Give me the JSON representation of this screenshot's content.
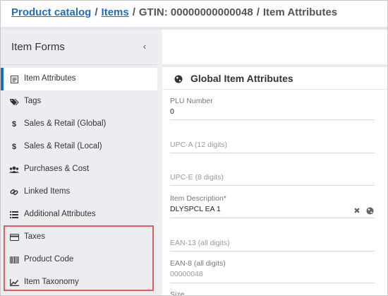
{
  "breadcrumb": {
    "product_catalog": "Product catalog",
    "sep1": "/",
    "items": "Items",
    "sep2": "/",
    "gtin": "GTIN: 00000000000048",
    "sep3": "/",
    "current": "Item Attributes"
  },
  "sidebar": {
    "title": "Item Forms",
    "collapse_glyph": "‹",
    "items": [
      {
        "label": "Item Attributes",
        "icon": "form-icon",
        "active": true
      },
      {
        "label": "Tags",
        "icon": "tags-icon"
      },
      {
        "label": "Sales & Retail (Global)",
        "icon": "dollar-icon"
      },
      {
        "label": "Sales & Retail (Local)",
        "icon": "dollar-icon"
      },
      {
        "label": "Purchases & Cost",
        "icon": "users-icon"
      },
      {
        "label": "Linked Items",
        "icon": "link-icon"
      },
      {
        "label": "Additional Attributes",
        "icon": "list-icon"
      },
      {
        "label": "Taxes",
        "icon": "credit-card-icon"
      },
      {
        "label": "Product Code",
        "icon": "barcode-icon"
      },
      {
        "label": "Item Taxonomy",
        "icon": "chart-line-icon"
      }
    ]
  },
  "panel": {
    "title": "Global Item Attributes",
    "fields": {
      "plu": {
        "label": "PLU Number",
        "value": "0"
      },
      "upca": {
        "placeholder": "UPC-A (12 digits)"
      },
      "upce": {
        "placeholder": "UPC-E (8 digits)"
      },
      "desc": {
        "label": "Item Description*",
        "value": "DLYSPCL EA 1"
      },
      "ean13": {
        "placeholder": "EAN-13 (all digits)"
      },
      "ean8": {
        "label": "EAN-8 (all digits)",
        "value": "00000048"
      },
      "size": {
        "label": "Size"
      }
    }
  },
  "colors": {
    "link": "#1a6fc4",
    "sidebar_bg": "#ebedf1",
    "highlight": "#e25c5c",
    "active_bar": "#1a6fc4"
  }
}
